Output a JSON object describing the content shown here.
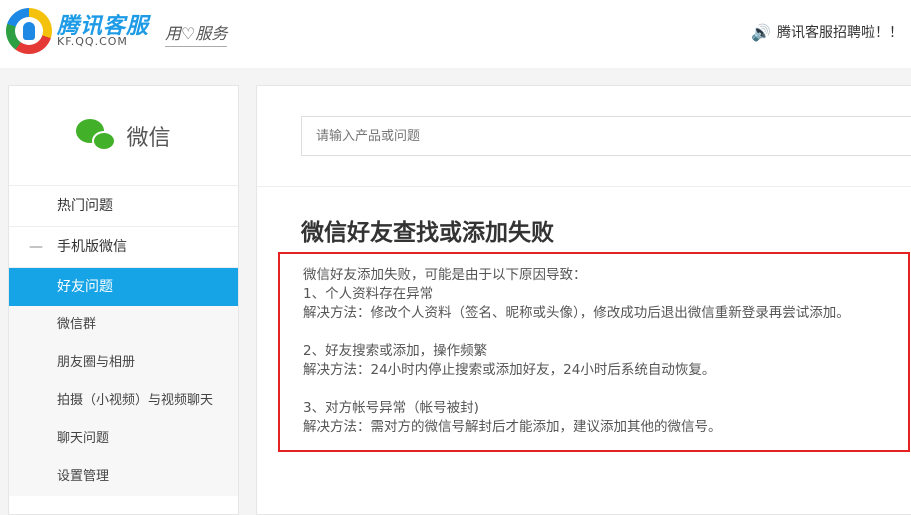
{
  "header": {
    "brand": "腾讯客服",
    "brand_sub": "KF.QQ.COM",
    "slogan": "用♡服务",
    "notice": "腾讯客服招聘啦！！"
  },
  "sidebar": {
    "title": "微信",
    "items": [
      {
        "label": "热门问题"
      },
      {
        "label": "手机版微信",
        "expanded_marker": "—"
      }
    ],
    "subitems": [
      {
        "label": "好友问题",
        "active": true
      },
      {
        "label": "微信群"
      },
      {
        "label": "朋友圈与相册"
      },
      {
        "label": "拍摄（小视频）与视频聊天"
      },
      {
        "label": "聊天问题"
      },
      {
        "label": "设置管理"
      }
    ]
  },
  "main": {
    "search_placeholder": "请输入产品或问题",
    "title": "微信好友查找或添加失败",
    "lines": [
      "微信好友添加失败，可能是由于以下原因导致：",
      "1、个人资料存在异常",
      "解决方法：修改个人资料（签名、昵称或头像），修改成功后退出微信重新登录再尝试添加。",
      "",
      "2、好友搜索或添加，操作频繁",
      "解决方法：24小时内停止搜索或添加好友，24小时后系统自动恢复。",
      "",
      "3、对方帐号异常（帐号被封)",
      "解决方法：需对方的微信号解封后才能添加，建议添加其他的微信号。"
    ]
  },
  "colors": {
    "accent": "#16a4e6",
    "highlight_border": "#e52222"
  }
}
